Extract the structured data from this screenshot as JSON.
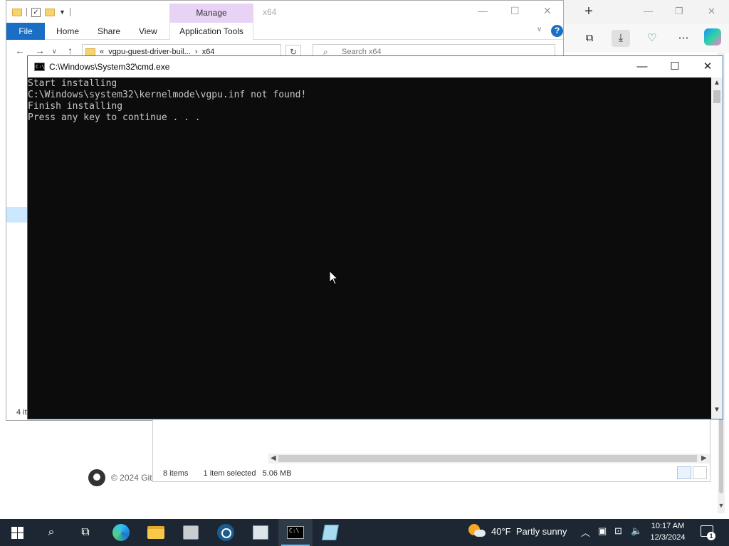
{
  "edge": {
    "newtab_icon": "plus-icon",
    "toolbar_icons": [
      "collections-icon",
      "downloads-icon",
      "browser-essentials-icon",
      "more-icon",
      "copilot-icon"
    ],
    "footer_text": "© 2024 Git"
  },
  "explorer": {
    "manage_tab": "Manage",
    "title": "x64",
    "ribbon_tabs": {
      "file": "File",
      "home": "Home",
      "share": "Share",
      "view": "View",
      "app_tools": "Application Tools"
    },
    "address_path": "vgpu-guest-driver-buil...",
    "address_current": "x64",
    "search_placeholder": "Search x64",
    "status_partial": "4 it"
  },
  "explorer2": {
    "item_count": "8 items",
    "selection": "1 item selected",
    "size": "5.06 MB"
  },
  "cmd": {
    "title": "C:\\Windows\\System32\\cmd.exe",
    "lines": [
      "Start installing",
      "C:\\Windows\\system32\\kernelmode\\vgpu.inf not found!",
      "Finish installing",
      "Press any key to continue . . ."
    ]
  },
  "taskbar": {
    "apps": [
      "start",
      "search",
      "task-view",
      "edge",
      "file-explorer",
      "app-installer",
      "steam",
      "photos",
      "cmd",
      "notepad"
    ],
    "weather_temp": "40°F",
    "weather_desc": "Partly sunny",
    "time": "10:17 AM",
    "date": "12/3/2024",
    "notification_count": "1"
  }
}
